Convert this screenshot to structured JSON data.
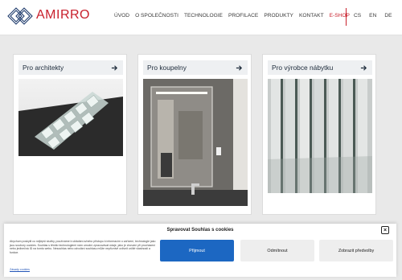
{
  "brand": {
    "name": "AMIRRO",
    "color": "#c8202c",
    "logo_icon": "diamond-logo-icon"
  },
  "nav": {
    "items": [
      {
        "label": "ÚVOD",
        "active": false
      },
      {
        "label": "O SPOLEČNOSTI",
        "active": false
      },
      {
        "label": "TECHNOLOGIE",
        "active": false
      },
      {
        "label": "PROFILACE",
        "active": false
      },
      {
        "label": "PRODUKTY",
        "active": false
      },
      {
        "label": "KONTAKT",
        "active": false
      },
      {
        "label": "E-SHOP",
        "active": true
      }
    ],
    "languages": [
      "CS",
      "EN",
      "DE"
    ]
  },
  "cards": [
    {
      "title": "Pro architekty",
      "icon": "arrow-right-icon",
      "image": "glass-tiles-photo"
    },
    {
      "title": "Pro koupelny",
      "icon": "arrow-right-icon",
      "image": "bathroom-mirror-photo"
    },
    {
      "title": "Pro výrobce nábytku",
      "icon": "arrow-right-icon",
      "image": "glass-panels-photo"
    }
  ],
  "cookie": {
    "title": "Spravovat Souhlas s cookies",
    "text": "Abychom poskytli co nejlepší služby, používáme k ukládání a/nebo přístupu k informacím o zařízení, technologie jako jsou soubory cookies. Souhlas s těmito technologiemi nám umožní zpracovávat údaje, jako je chování při procházení nebo jedinečná ID na tomto webu. Nesouhlas nebo odvolání souhlasu může nepříznivě ovlivnit určité vlastnosti a funkce.",
    "link": "Zásady cookies",
    "accept": "Přijmout",
    "deny": "Odmítnout",
    "prefs": "Zobrazit předvolby",
    "accent": "#1c67c2"
  }
}
